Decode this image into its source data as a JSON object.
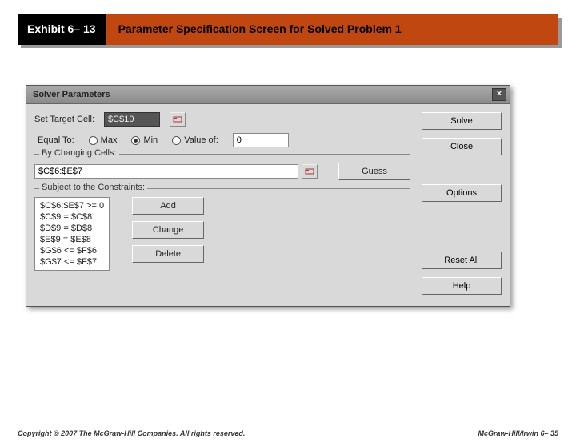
{
  "header": {
    "exhibit": "Exhibit 6– 13",
    "title": "Parameter Specification Screen for Solved Problem 1"
  },
  "dialog": {
    "title": "Solver Parameters",
    "target_label": "Set Target Cell:",
    "target_value": "$C$10",
    "equal_to_label": "Equal To:",
    "radios": {
      "max": "Max",
      "min": "Min",
      "value_of": "Value of:"
    },
    "selected_radio": "min",
    "value_of": "0",
    "changing_group": "By Changing Cells:",
    "changing_value": "$C$6:$E$7",
    "constraints_group": "Subject to the Constraints:",
    "constraints": [
      "$C$6:$E$7 >= 0",
      "$C$9 = $C$8",
      "$D$9 = $D$8",
      "$E$9 = $E$8",
      "$G$6 <= $F$6",
      "$G$7 <= $F$7"
    ],
    "buttons": {
      "solve": "Solve",
      "close": "Close",
      "guess": "Guess",
      "options": "Options",
      "add": "Add",
      "change": "Change",
      "delete": "Delete",
      "reset": "Reset All",
      "help": "Help"
    }
  },
  "footer": {
    "left": "Copyright © 2007 The McGraw-Hill Companies. All rights reserved.",
    "right": "McGraw-Hill/Irwin   6– 35"
  }
}
